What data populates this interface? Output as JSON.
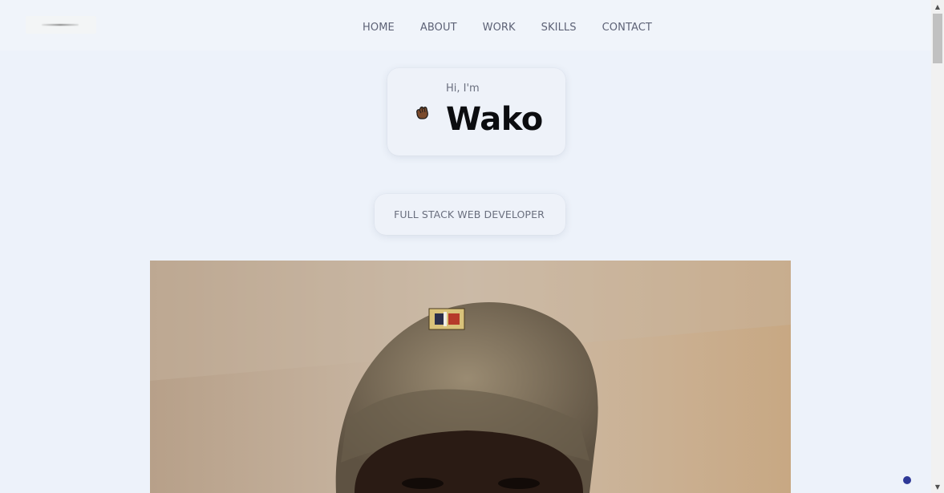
{
  "nav": {
    "items": [
      "HOME",
      "ABOUT",
      "WORK",
      "SKILLS",
      "CONTACT"
    ]
  },
  "hero": {
    "greeting": "Hi, I'm",
    "name": "Wako",
    "role": "FULL STACK WEB DEVELOPER"
  },
  "icons": {
    "logo": "logo-image",
    "wave": "waving-hand-icon",
    "scroll_up": "scroll-up-arrow-icon",
    "scroll_down": "scroll-down-arrow-icon"
  },
  "colors": {
    "background": "#edf2fa",
    "header": "#f0f4fa",
    "nav_text": "#5d6276",
    "name_text": "#0c0d10",
    "accent_dot": "#2e3897"
  }
}
